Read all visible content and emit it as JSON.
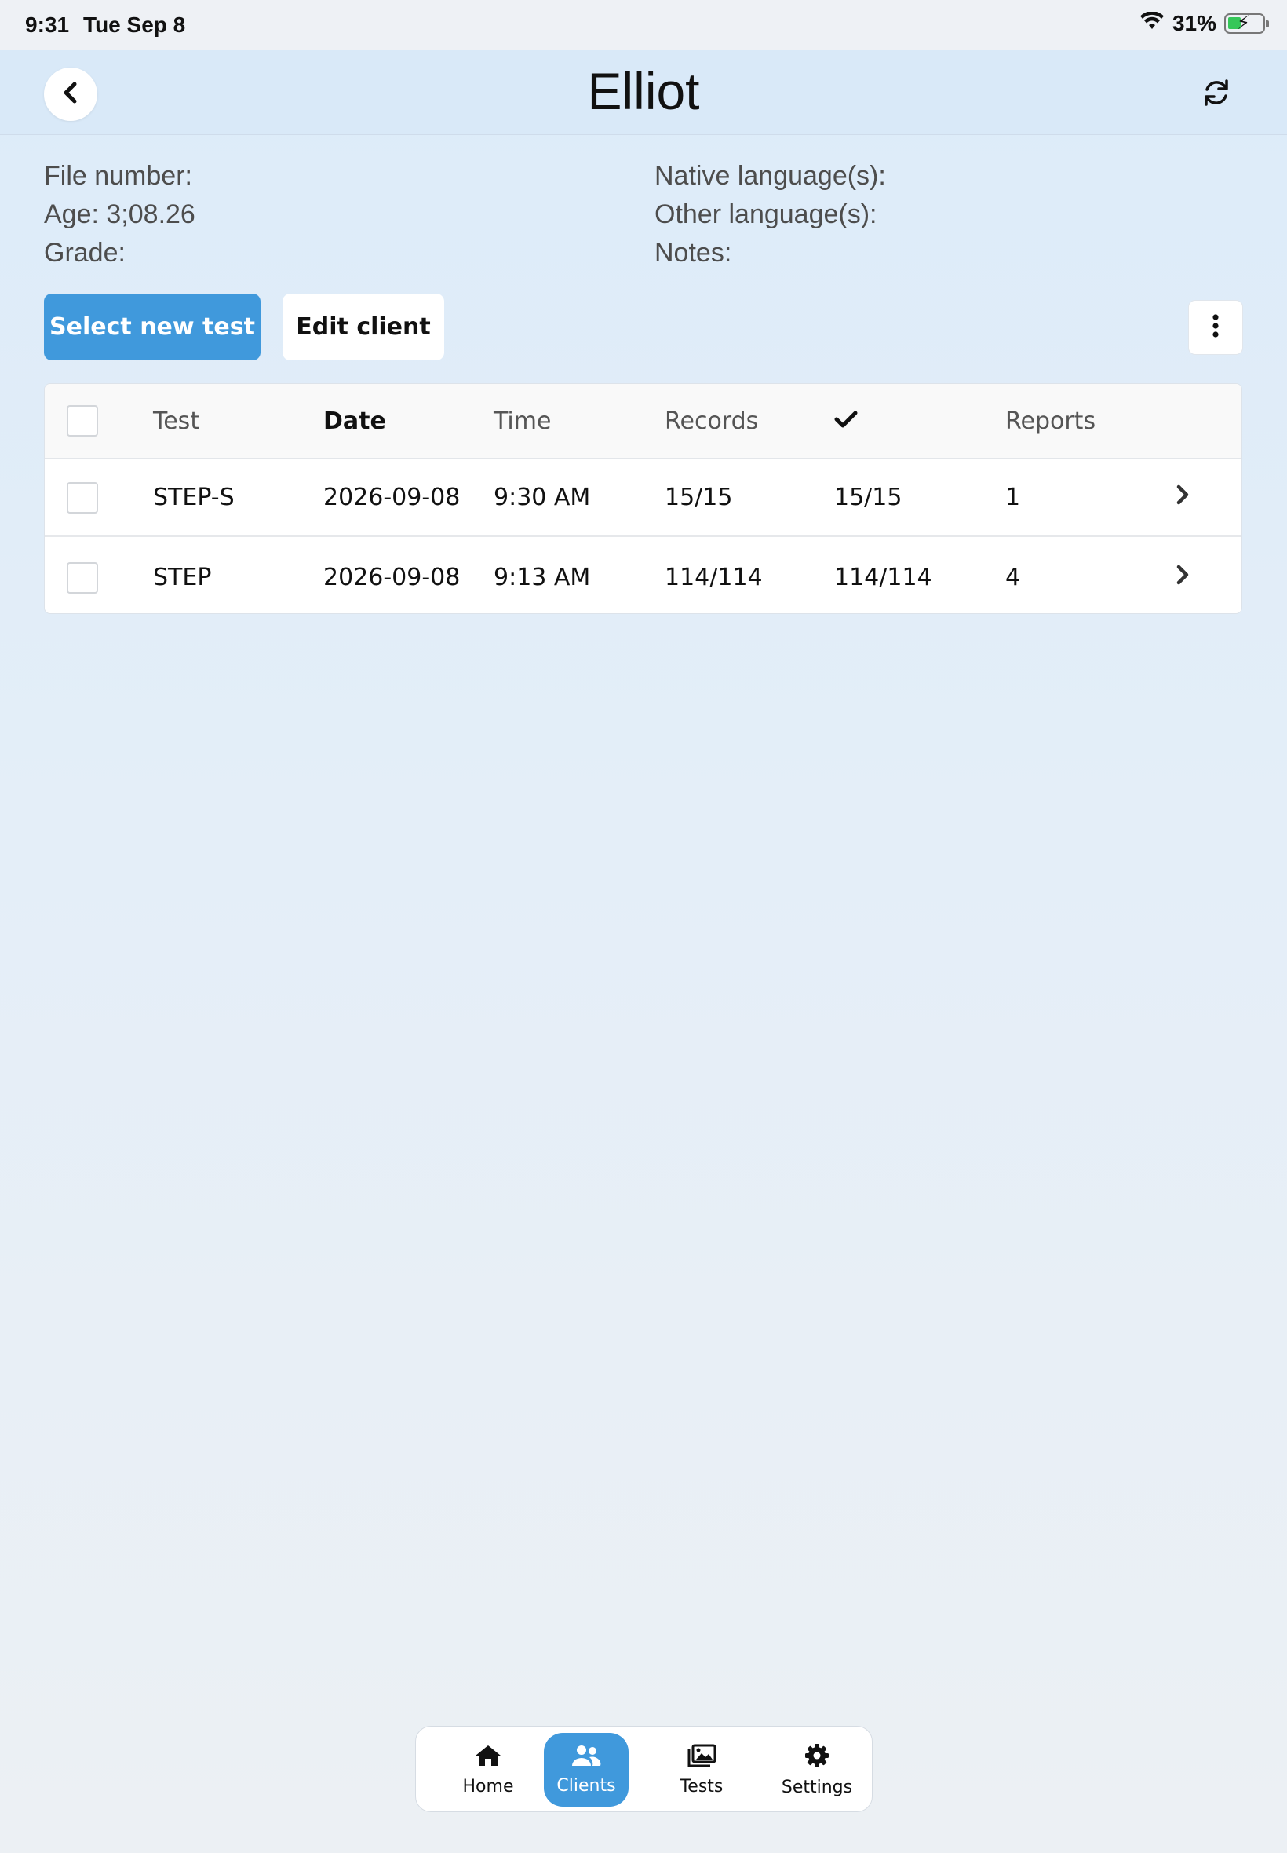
{
  "status_bar": {
    "time": "9:31",
    "date": "Tue Sep 8",
    "battery": "31%"
  },
  "header": {
    "title": "Elliot"
  },
  "client_info": {
    "file_number": "File number:",
    "age": "Age: 3;08.26",
    "grade": "Grade:",
    "native_languages": "Native language(s):",
    "other_languages": "Other language(s):",
    "notes": "Notes:"
  },
  "actions": {
    "select_new_test": "Select new test",
    "edit_client": "Edit client"
  },
  "table": {
    "headers": {
      "test": "Test",
      "date": "Date",
      "time": "Time",
      "records": "Records",
      "reports": "Reports"
    },
    "rows": [
      {
        "test": "STEP-S",
        "date": "2026-09-08",
        "time": "9:30 AM",
        "records": "15/15",
        "completed": "15/15",
        "reports": "1"
      },
      {
        "test": "STEP",
        "date": "2026-09-08",
        "time": "9:13 AM",
        "records": "114/114",
        "completed": "114/114",
        "reports": "4"
      }
    ]
  },
  "tabbar": {
    "home": "Home",
    "clients": "Clients",
    "tests": "Tests",
    "settings": "Settings",
    "active": "clients"
  },
  "colors": {
    "accent": "#4099dc",
    "battery_fill": "#35c759"
  }
}
